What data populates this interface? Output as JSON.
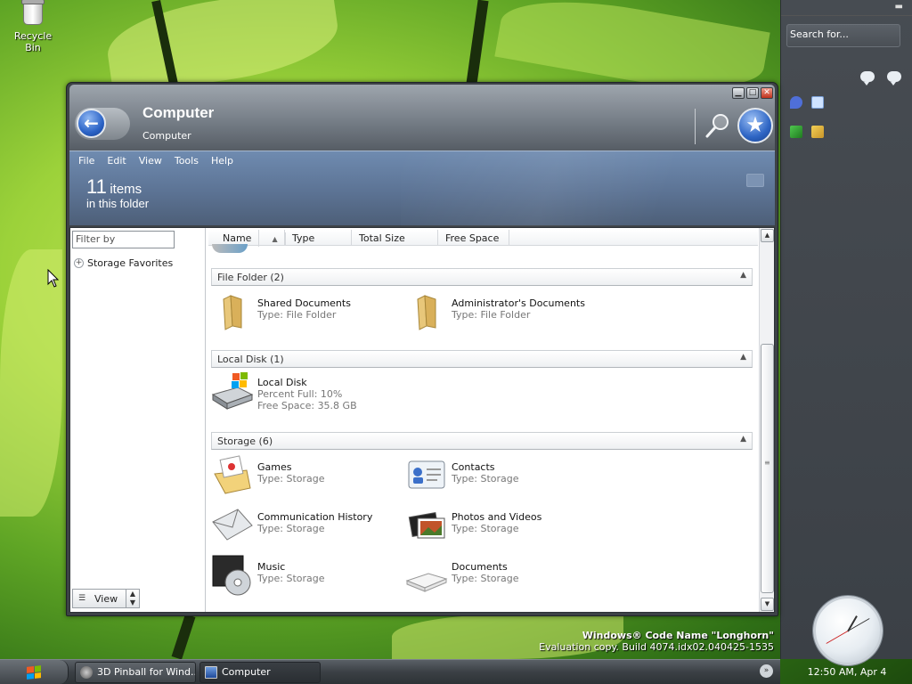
{
  "desktop": {
    "recycle_bin_label": "Recycle Bin"
  },
  "sidebar": {
    "search_placeholder": "Search for...",
    "clock_label": "12:50 AM, Apr 4"
  },
  "watermark": {
    "line1": "Windows® Code Name \"Longhorn\"",
    "line2": "Evaluation copy. Build 4074.idx02.040425-1535"
  },
  "taskbar": {
    "tasks": [
      {
        "label": "3D Pinball for Wind...",
        "icon": "pinball-icon"
      },
      {
        "label": "Computer",
        "icon": "computer-icon"
      }
    ]
  },
  "window": {
    "title": "Computer",
    "breadcrumb": "Computer",
    "menu": [
      "File",
      "Edit",
      "View",
      "Tools",
      "Help"
    ],
    "count_number": "11",
    "count_items": "items",
    "count_folder": "in this folder",
    "filter_placeholder": "Filter by",
    "storage_favorites": "Storage Favorites",
    "view_label": "View",
    "columns": [
      "Name",
      "Type",
      "Total Size",
      "Free Space"
    ],
    "groups": [
      {
        "header": "File Folder (2)",
        "items": [
          {
            "name": "Shared Documents",
            "sub": "Type: File Folder",
            "icon": "folder-icon"
          },
          {
            "name": "Administrator's Documents",
            "sub": "Type: File Folder",
            "icon": "folder-icon"
          }
        ]
      },
      {
        "header": "Local Disk (1)",
        "items": [
          {
            "name": "Local Disk",
            "sub": "Percent Full: 10%",
            "sub2": "Free Space: 35.8 GB",
            "icon": "hard-disk-icon"
          }
        ]
      },
      {
        "header": "Storage (6)",
        "items": [
          {
            "name": "Games",
            "sub": "Type: Storage",
            "icon": "games-folder-icon"
          },
          {
            "name": "Contacts",
            "sub": "Type: Storage",
            "icon": "contacts-icon"
          },
          {
            "name": "Communication History",
            "sub": "Type: Storage",
            "icon": "envelope-icon"
          },
          {
            "name": "Photos and Videos",
            "sub": "Type: Storage",
            "icon": "photos-icon"
          },
          {
            "name": "Music",
            "sub": "Type: Storage",
            "icon": "music-disc-icon"
          },
          {
            "name": "Documents",
            "sub": "Type: Storage",
            "icon": "documents-icon"
          }
        ]
      }
    ]
  }
}
